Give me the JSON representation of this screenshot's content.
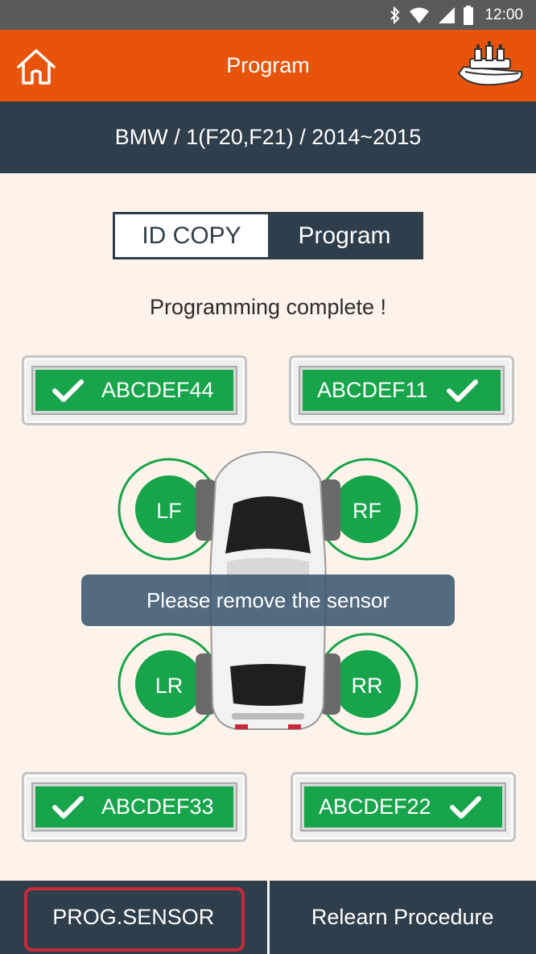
{
  "statusbar": {
    "time": "12:00",
    "icons": [
      "bluetooth-icon",
      "wifi-icon",
      "signal-icon",
      "battery-icon"
    ]
  },
  "appbar": {
    "title": "Program",
    "left_icon": "home-icon",
    "right_icon": "tpms-tool-icon"
  },
  "vehicle": {
    "path": "BMW / 1(F20,F21) / 2014~2015"
  },
  "mode_toggle": {
    "options": [
      "ID COPY",
      "Program"
    ],
    "selected": "Program"
  },
  "status_message": "Programming complete !",
  "sensors": {
    "front_left": {
      "id": "ABCDEF44",
      "status": "ok"
    },
    "front_right": {
      "id": "ABCDEF11",
      "status": "ok"
    },
    "rear_left": {
      "id": "ABCDEF33",
      "status": "ok"
    },
    "rear_right": {
      "id": "ABCDEF22",
      "status": "ok"
    }
  },
  "wheels": {
    "lf": "LF",
    "rf": "RF",
    "lr": "LR",
    "rr": "RR"
  },
  "toast": "Please remove the sensor",
  "bottom_buttons": {
    "prog_sensor": "PROG.SENSOR",
    "relearn": "Relearn Procedure"
  },
  "colors": {
    "accent": "#e8540b",
    "navy": "#2f3e4b",
    "success": "#17a44a",
    "background": "#fdf3ea",
    "focus": "#c92a39"
  }
}
